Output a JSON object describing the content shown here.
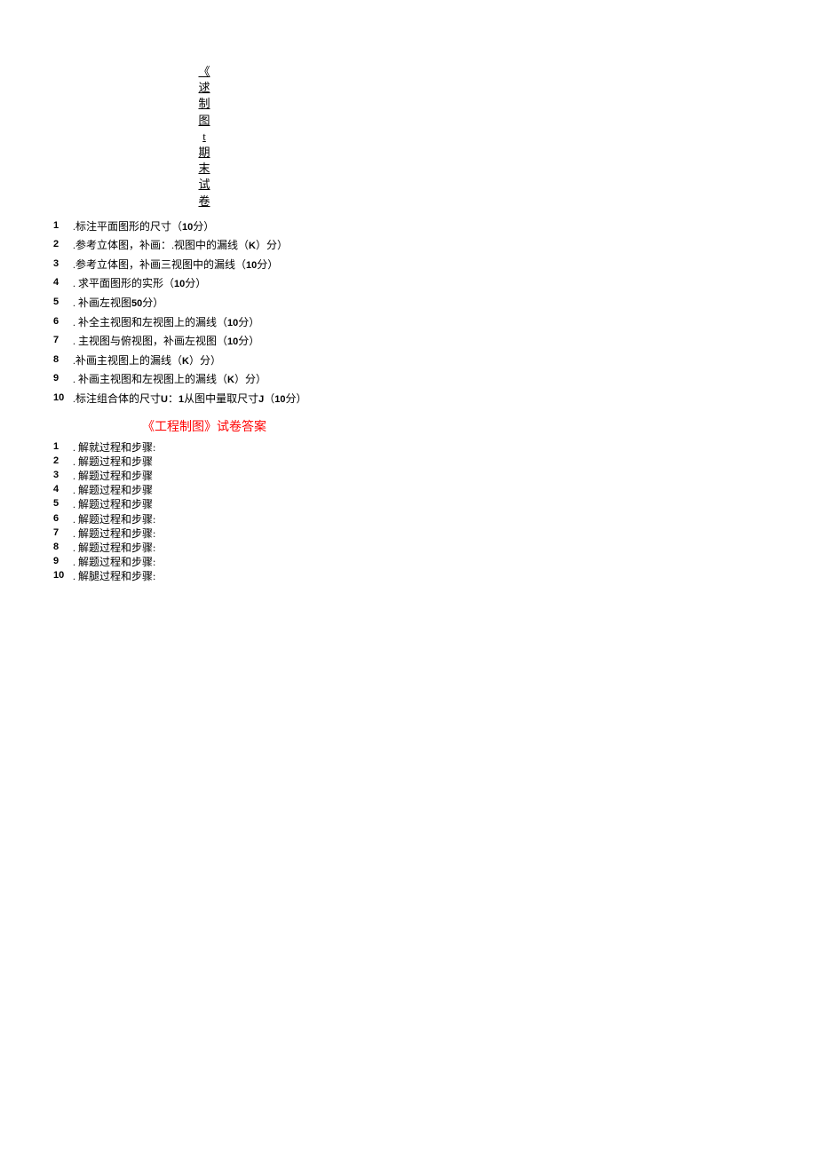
{
  "title_chars": [
    "《",
    "逑",
    "制",
    "图",
    "t",
    "期",
    "末",
    "试",
    "卷"
  ],
  "questions": [
    {
      "num": "1",
      "pre": ".标注平面图形的尺寸（",
      "b1": "10",
      "post": "分）"
    },
    {
      "num": "2",
      "pre": ".参考立体图，补画：.视图中的漏线（",
      "b1": "K",
      "post": "）分）"
    },
    {
      "num": "3",
      "pre": ".参考立体图，补画三视图中的漏线（",
      "b1": "10",
      "post": "分）"
    },
    {
      "num": "4",
      "pre": "  . 求平面图形的实形（",
      "b1": "10",
      "post": "分）"
    },
    {
      "num": "5",
      "pre": "  . 补画左视图",
      "b1": "50",
      "post": "分）"
    },
    {
      "num": "6",
      "pre": "  . 补全主视图和左视图上的漏线（",
      "b1": "10",
      "post": "分）"
    },
    {
      "num": "7",
      "pre": "  . 主视图与俯视图，补画左视图（",
      "b1": "10",
      "post": "分）"
    },
    {
      "num": "8",
      "pre": ".补画主视图上的漏线（",
      "b1": "K",
      "post": "）分）"
    },
    {
      "num": "9",
      "pre": "  . 补画主视图和左视图上的漏线（",
      "b1": "K",
      "post": "）分）"
    }
  ],
  "q10": {
    "num": "10",
    "pre": "  .标注组合体的尺寸",
    "b1": "U",
    "mid": "：",
    "b2": "1",
    "mid2": "从图中量取尺寸",
    "b3": "J",
    "mid3": "（",
    "b4": "10",
    "post": "分）"
  },
  "answer_title": "《工程制图》试卷答案",
  "answers": [
    {
      "num": "1",
      "text": "  . 解就过程和步骤:"
    },
    {
      "num": "2",
      "text": "  . 解题过程和步骤"
    },
    {
      "num": "3",
      "text": "  . 解题过程和步骤"
    },
    {
      "num": "4",
      "text": "  . 解题过程和步骤"
    },
    {
      "num": "5",
      "text": "  . 解题过程和步骤"
    },
    {
      "num": "6",
      "text": "  . 解题过程和步骤:"
    },
    {
      "num": "7",
      "text": "  . 解题过程和步骤:"
    },
    {
      "num": "8",
      "text": "  . 解题过程和步骤:"
    },
    {
      "num": "9",
      "text": "  . 解题过程和步骤:"
    },
    {
      "num": "10",
      "text": "  . 解腿过程和步骤:"
    }
  ]
}
